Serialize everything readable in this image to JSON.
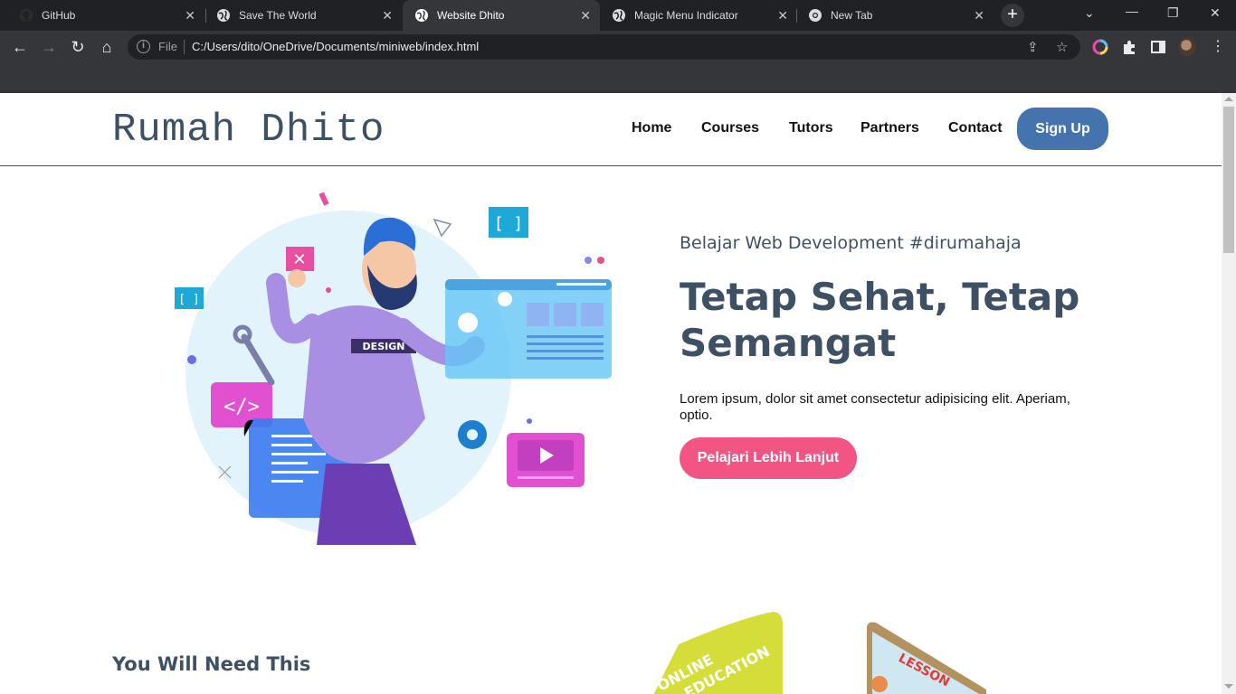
{
  "browser": {
    "tabs": [
      {
        "title": "GitHub",
        "active": false
      },
      {
        "title": "Save The World",
        "active": false
      },
      {
        "title": "Website Dhito",
        "active": true
      },
      {
        "title": "Magic Menu Indicator",
        "active": false
      },
      {
        "title": "New Tab",
        "active": false
      }
    ],
    "address": {
      "scheme_label": "File",
      "url": "C:/Users/dito/OneDrive/Documents/miniweb/index.html"
    }
  },
  "site": {
    "logo": "Rumah Dhito",
    "nav": [
      "Home",
      "Courses",
      "Tutors",
      "Partners",
      "Contact"
    ],
    "signup": "Sign Up",
    "hero": {
      "subtitle": "Belajar Web Development #dirumahaja",
      "title": "Tetap Sehat, Tetap Semangat",
      "text": "Lorem ipsum, dolor sit amet consectetur adipisicing elit. Aperiam, optio.",
      "cta": "Pelajari Lebih Lanjut",
      "illustration_badge": "DESIGN"
    },
    "section_title": "You Will Need This",
    "card_texts": [
      "ONLINE",
      "EDUCATION",
      "LESSON"
    ]
  },
  "colors": {
    "brand_dark": "#3e5063",
    "signup_blue": "#4573ae",
    "cta_pink": "#f25584"
  }
}
